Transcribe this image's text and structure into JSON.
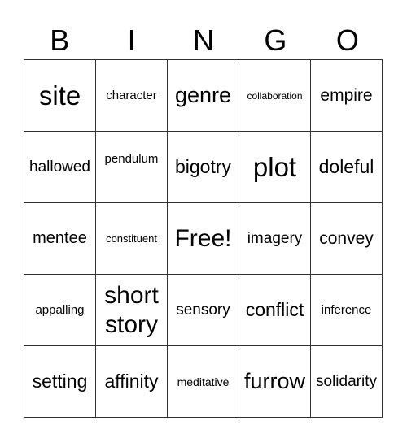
{
  "header": [
    "B",
    "I",
    "N",
    "G",
    "O"
  ],
  "rows": [
    [
      "site",
      "character",
      "genre",
      "collaboration",
      "empire"
    ],
    [
      "hallowed",
      "pendulum",
      "bigotry",
      "plot",
      "doleful"
    ],
    [
      "mentee",
      "constituent",
      "Free!",
      "imagery",
      "convey"
    ],
    [
      "appalling",
      "short story",
      "sensory",
      "conflict",
      "inference"
    ],
    [
      "setting",
      "affinity",
      "meditative",
      "furrow",
      "solidarity"
    ]
  ]
}
